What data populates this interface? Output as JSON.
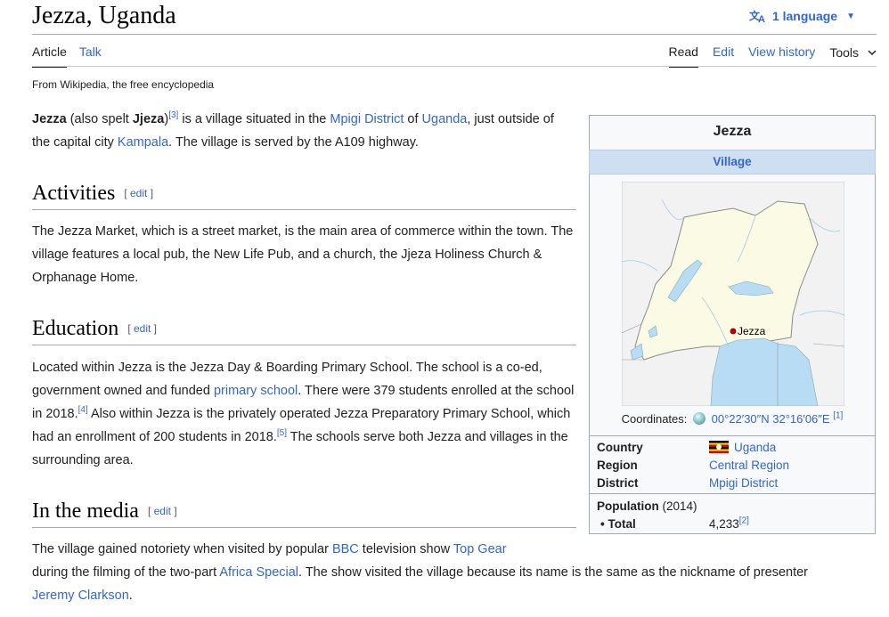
{
  "page": {
    "title": "Jezza, Uganda",
    "language_button": "1 language",
    "tabs_left": [
      "Article",
      "Talk"
    ],
    "tabs_right": [
      "Read",
      "Edit",
      "View history",
      "Tools"
    ],
    "tagline": "From Wikipedia, the free encyclopedia"
  },
  "intro": {
    "b1": "Jezza",
    "t1": " (also spelt ",
    "b2": "Jjeza",
    "t2": ")",
    "ref": "[3]",
    "t3": " is a village situated in the ",
    "link1": "Mpigi District",
    "t4": " of ",
    "link2": "Uganda",
    "t5": ", just outside of the capital city ",
    "link3": "Kampala",
    "t6": ". The village is served by the A109 highway."
  },
  "sections": {
    "edit_label": "edit",
    "activities": {
      "heading": "Activities",
      "text": "The Jezza Market, which is a street market, is the main area of commerce within the town. The village features a local pub, the New Life Pub, and a church, the Jjeza Holiness Church & Orphanage Home."
    },
    "education": {
      "heading": "Education",
      "t1": "Located within Jezza is the Jezza Day & Boarding Primary School. The school is a co-ed, government owned and funded ",
      "link1": "primary school",
      "t2": ". There were 379 students enrolled at the school in 2018.",
      "ref1": "[4]",
      "t3": " Also within Jezza is the privately operated Jezza Preparatory Primary School, which had an enrollment of 200 students in 2018.",
      "ref2": "[5]",
      "t4": " The schools serve both Jezza and villages in the surrounding area."
    },
    "media": {
      "heading": "In the media",
      "t1": "The village gained notoriety when visited by popular ",
      "link1": "BBC",
      "t2": " television show ",
      "link2": "Top Gear",
      "t3": " during the filming of the two-part ",
      "link3": "Africa Special",
      "t4": ". The show visited the village because its name is the same as the nickname of presenter ",
      "link4": "Jeremy Clarkson",
      "t5": "."
    }
  },
  "infobox": {
    "title": "Jezza",
    "type": "Village",
    "map_label": "Jezza",
    "coords_label": "Coordinates:",
    "coords": "00°22′30″N 32°16′06″E",
    "coords_ref": "[1]",
    "rows": [
      {
        "label": "Country",
        "value": "Uganda"
      },
      {
        "label": "Region",
        "value": "Central Region"
      },
      {
        "label": "District",
        "value": "Mpigi District"
      }
    ],
    "population_label": "Population",
    "population_year": " (2014)",
    "total_label": "• Total",
    "total_value": "4,233",
    "total_ref": "[2]"
  },
  "colors": {
    "link": "#3366cc",
    "map_land": "#fbfbe5",
    "map_water": "#b7dcf4",
    "infobox_header": "#cedff2"
  }
}
